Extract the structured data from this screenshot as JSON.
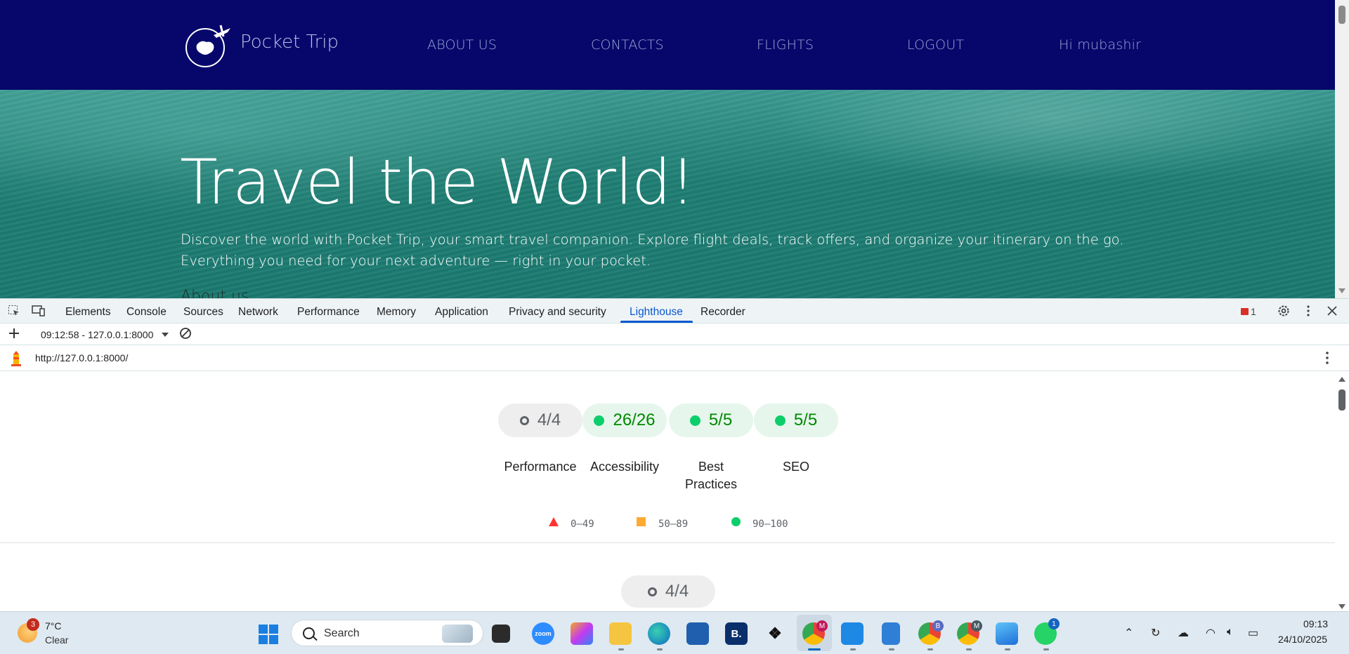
{
  "site": {
    "brand": "Pocket Trip",
    "logo_text_top": "POCKET",
    "logo_text_bottom": "TRIP",
    "nav": [
      "ABOUT US",
      "CONTACTS",
      "FLIGHTS",
      "LOGOUT",
      "Hi mubashir"
    ],
    "hero_title": "Travel the World!",
    "hero_text": "Discover the world with Pocket Trip, your smart travel companion. Explore flight deals, track offers, and organize your itinerary on the go. Everything you need for your next adventure — right in your pocket.",
    "next_section": "About us"
  },
  "devtools": {
    "tabs": [
      "Elements",
      "Console",
      "Sources",
      "Network",
      "Performance",
      "Memory",
      "Application",
      "Privacy and security",
      "Lighthouse",
      "Recorder"
    ],
    "active_tab": "Lighthouse",
    "error_count": "1",
    "report_select": "09:12:58 - 127.0.0.1:8000",
    "report_url": "http://127.0.0.1:8000/"
  },
  "lighthouse": {
    "gauges": [
      {
        "score": "4/4",
        "label": "Performance",
        "status": "neutral",
        "color": "#5f6368"
      },
      {
        "score": "26/26",
        "label": "Accessibility",
        "status": "pass",
        "color": "#008800"
      },
      {
        "score": "5/5",
        "label": "Best Practices",
        "status": "pass",
        "color": "#008800"
      },
      {
        "score": "5/5",
        "label": "SEO",
        "status": "pass",
        "color": "#008800"
      }
    ],
    "legend": [
      {
        "range": "0–49",
        "shape": "triangle",
        "color": "#ff3333"
      },
      {
        "range": "50–89",
        "shape": "square",
        "color": "#ffaa33"
      },
      {
        "range": "90–100",
        "shape": "circle",
        "color": "#0cce6b"
      }
    ],
    "section_score": "4/4"
  },
  "taskbar": {
    "weather_temp": "7°C",
    "weather_cond": "Clear",
    "weather_badge": "3",
    "search_label": "Search",
    "apps": [
      "file-explorer-app",
      "zoom-app",
      "copilot-app",
      "folder-app",
      "edge-app",
      "store-app",
      "booking-app",
      "dropbox-app",
      "chrome-app",
      "vscode-app",
      "notepad-app",
      "chrome-profile-b-app",
      "chrome-profile-m-app",
      "photos-app",
      "whatsapp-app"
    ],
    "zoom_label": "zoom",
    "booking_label": "B.",
    "chrome_badge": "M",
    "chrome_b_badge": "B",
    "chrome_m_badge": "M",
    "whatsapp_badge": "1",
    "clock_time": "09:13",
    "clock_date": "24/10/2025"
  },
  "colors": {
    "nav_bg": "#07076b",
    "devtools_accent": "#0b57d0",
    "pass_green": "#0cce6b"
  }
}
